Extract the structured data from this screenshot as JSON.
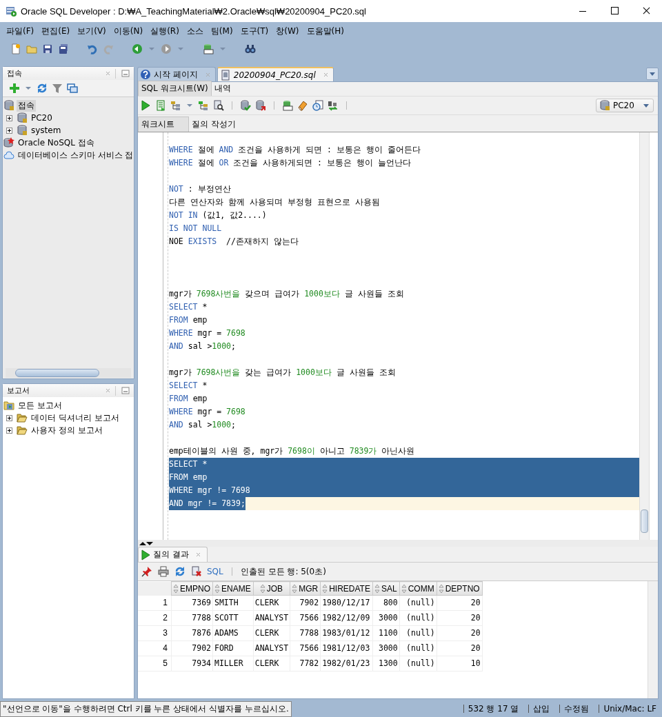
{
  "window": {
    "title": "Oracle SQL Developer : D:₩A_TeachingMaterial₩2.Oracle₩sql₩20200904_PC20.sql"
  },
  "menu": [
    "파일(F)",
    "편집(E)",
    "보기(V)",
    "이동(N)",
    "실행(R)",
    "소스",
    "팀(M)",
    "도구(T)",
    "창(W)",
    "도움말(H)"
  ],
  "connections_panel": {
    "title": "접속",
    "tree": [
      {
        "label": "접속",
        "selected": true,
        "children": [
          {
            "label": "PC20",
            "selected": false,
            "expanded": false
          },
          {
            "label": "system",
            "selected": false,
            "expanded": false
          }
        ]
      },
      {
        "label": "Oracle NoSQL 접속",
        "selected": false
      },
      {
        "label": "데이터베이스 스키마 서비스 접",
        "selected": false
      }
    ]
  },
  "reports_panel": {
    "title": "보고서",
    "tree": [
      {
        "label": "모든 보고서",
        "children": [
          {
            "label": "데이터 딕셔너리 보고서",
            "expanded": false
          },
          {
            "label": "사용자 정의 보고서",
            "expanded": false
          }
        ]
      }
    ]
  },
  "editor_tabs": [
    {
      "label": "시작 페이지",
      "selected": false
    },
    {
      "label": "20200904_PC20.sql",
      "selected": true
    }
  ],
  "worksheet_tabs": [
    {
      "label": "SQL 워크시트(W)",
      "selected": true
    },
    {
      "label": "내역",
      "selected": false
    }
  ],
  "connection_select": {
    "value": "PC20"
  },
  "sub_tabs": [
    {
      "label": "워크시트",
      "selected": true
    },
    {
      "label": "질의 작성기",
      "selected": false
    }
  ],
  "editor": {
    "lines": [
      {
        "selected": false,
        "current": false,
        "tokens": [
          {
            "kind": "keyword",
            "text": "WHERE"
          },
          {
            "kind": "plain",
            "text": " 절에 "
          },
          {
            "kind": "keyword",
            "text": "AND"
          },
          {
            "kind": "plain",
            "text": " 조건을 사용하게 되면 : 보통은 행이 줄어든다"
          }
        ]
      },
      {
        "selected": false,
        "current": false,
        "tokens": [
          {
            "kind": "keyword",
            "text": "WHERE"
          },
          {
            "kind": "plain",
            "text": " 절에 "
          },
          {
            "kind": "keyword",
            "text": "OR"
          },
          {
            "kind": "plain",
            "text": " 조건을 사용하게되면 : 보통은 행이 늘언난다"
          }
        ]
      },
      {
        "selected": false,
        "current": false
      },
      {
        "selected": false,
        "current": false,
        "tokens": [
          {
            "kind": "keyword",
            "text": "NOT"
          },
          {
            "kind": "plain",
            "text": " : 부정연산"
          }
        ]
      },
      {
        "selected": false,
        "current": false,
        "tokens": [
          {
            "kind": "plain",
            "text": "다른 연산자와 함께 사용되며 부정형 표현으로 사용됨"
          }
        ]
      },
      {
        "selected": false,
        "current": false,
        "tokens": [
          {
            "kind": "keyword",
            "text": "NOT IN"
          },
          {
            "kind": "plain",
            "text": " (값1, 값2....)"
          }
        ]
      },
      {
        "selected": false,
        "current": false,
        "tokens": [
          {
            "kind": "keyword",
            "text": "IS NOT NULL"
          }
        ]
      },
      {
        "selected": false,
        "current": false,
        "tokens": [
          {
            "kind": "plain",
            "text": "NOE "
          },
          {
            "kind": "keyword",
            "text": "EXISTS"
          },
          {
            "kind": "plain",
            "text": "  //존재하지 않는다"
          }
        ]
      },
      {
        "selected": false,
        "current": false
      },
      {
        "selected": false,
        "current": false
      },
      {
        "selected": false,
        "current": false
      },
      {
        "selected": false,
        "current": false,
        "tokens": [
          {
            "kind": "plain",
            "text": "mgr가 "
          },
          {
            "kind": "number",
            "text": "7698사번을"
          },
          {
            "kind": "plain",
            "text": " 갖으며 급여가 "
          },
          {
            "kind": "number",
            "text": "1000보다"
          },
          {
            "kind": "plain",
            "text": " 글 사원들 조회"
          }
        ]
      },
      {
        "selected": false,
        "current": false,
        "tokens": [
          {
            "kind": "keyword",
            "text": "SELECT"
          },
          {
            "kind": "plain",
            "text": " *"
          }
        ]
      },
      {
        "selected": false,
        "current": false,
        "tokens": [
          {
            "kind": "keyword",
            "text": "FROM"
          },
          {
            "kind": "plain",
            "text": " emp"
          }
        ]
      },
      {
        "selected": false,
        "current": false,
        "tokens": [
          {
            "kind": "keyword",
            "text": "WHERE"
          },
          {
            "kind": "plain",
            "text": " mgr = "
          },
          {
            "kind": "number",
            "text": "7698"
          }
        ]
      },
      {
        "selected": false,
        "current": false,
        "tokens": [
          {
            "kind": "keyword",
            "text": "AND"
          },
          {
            "kind": "plain",
            "text": " sal >"
          },
          {
            "kind": "number",
            "text": "1000"
          },
          {
            "kind": "plain",
            "text": ";"
          }
        ]
      },
      {
        "selected": false,
        "current": false
      },
      {
        "selected": false,
        "current": false,
        "tokens": [
          {
            "kind": "plain",
            "text": "mgr가 "
          },
          {
            "kind": "number",
            "text": "7698사번을"
          },
          {
            "kind": "plain",
            "text": " 갖는 급여가 "
          },
          {
            "kind": "number",
            "text": "1000보다"
          },
          {
            "kind": "plain",
            "text": " 글 사원들 조회"
          }
        ]
      },
      {
        "selected": false,
        "current": false,
        "tokens": [
          {
            "kind": "keyword",
            "text": "SELECT"
          },
          {
            "kind": "plain",
            "text": " *"
          }
        ]
      },
      {
        "selected": false,
        "current": false,
        "tokens": [
          {
            "kind": "keyword",
            "text": "FROM"
          },
          {
            "kind": "plain",
            "text": " emp"
          }
        ]
      },
      {
        "selected": false,
        "current": false,
        "tokens": [
          {
            "kind": "keyword",
            "text": "WHERE"
          },
          {
            "kind": "plain",
            "text": " mgr = "
          },
          {
            "kind": "number",
            "text": "7698"
          }
        ]
      },
      {
        "selected": false,
        "current": false,
        "tokens": [
          {
            "kind": "keyword",
            "text": "AND"
          },
          {
            "kind": "plain",
            "text": " sal >"
          },
          {
            "kind": "number",
            "text": "1000"
          },
          {
            "kind": "plain",
            "text": ";"
          }
        ]
      },
      {
        "selected": false,
        "current": false
      },
      {
        "selected": false,
        "current": false,
        "tokens": [
          {
            "kind": "plain",
            "text": "emp테이블의 사원 중, mgr가 "
          },
          {
            "kind": "number",
            "text": "7698이"
          },
          {
            "kind": "plain",
            "text": " 아니고 "
          },
          {
            "kind": "number",
            "text": "7839가"
          },
          {
            "kind": "plain",
            "text": " 아닌사원"
          }
        ]
      },
      {
        "selected": true,
        "current": false,
        "tokens": [
          {
            "kind": "keyword",
            "text": "SELECT"
          },
          {
            "kind": "plain",
            "text": " *"
          }
        ]
      },
      {
        "selected": true,
        "current": false,
        "tokens": [
          {
            "kind": "keyword",
            "text": "FROM"
          },
          {
            "kind": "plain",
            "text": " emp"
          }
        ]
      },
      {
        "selected": true,
        "current": false,
        "tokens": [
          {
            "kind": "keyword",
            "text": "WHERE"
          },
          {
            "kind": "plain",
            "text": " mgr != "
          },
          {
            "kind": "number",
            "text": "7698"
          }
        ]
      },
      {
        "selected": true,
        "current": true,
        "tokens": [
          {
            "kind": "keyword",
            "text": "AND"
          },
          {
            "kind": "plain",
            "text": " mgr != "
          },
          {
            "kind": "number",
            "text": "7839"
          },
          {
            "kind": "plain",
            "text": ";"
          }
        ]
      }
    ]
  },
  "results": {
    "tab": "질의 결과",
    "sql_link": "SQL",
    "message": "인출된 모든 행: 5(0초)",
    "columns": [
      {
        "label": "EMPNO",
        "kind": "number"
      },
      {
        "label": "ENAME",
        "kind": "text"
      },
      {
        "label": "JOB",
        "kind": "text"
      },
      {
        "label": "MGR",
        "kind": "number"
      },
      {
        "label": "HIREDATE",
        "kind": "text"
      },
      {
        "label": "SAL",
        "kind": "number"
      },
      {
        "label": "COMM",
        "kind": "number"
      },
      {
        "label": "DEPTNO",
        "kind": "number"
      }
    ],
    "rows": [
      {
        "number": "1",
        "cells": [
          "7369",
          "SMITH",
          "CLERK",
          "7902",
          "1980/12/17",
          "800",
          "(null)",
          "20"
        ]
      },
      {
        "number": "2",
        "cells": [
          "7788",
          "SCOTT",
          "ANALYST",
          "7566",
          "1982/12/09",
          "3000",
          "(null)",
          "20"
        ]
      },
      {
        "number": "3",
        "cells": [
          "7876",
          "ADAMS",
          "CLERK",
          "7788",
          "1983/01/12",
          "1100",
          "(null)",
          "20"
        ]
      },
      {
        "number": "4",
        "cells": [
          "7902",
          "FORD",
          "ANALYST",
          "7566",
          "1981/12/03",
          "3000",
          "(null)",
          "20"
        ]
      },
      {
        "number": "5",
        "cells": [
          "7934",
          "MILLER",
          "CLERK",
          "7782",
          "1982/01/23",
          "1300",
          "(null)",
          "10"
        ]
      }
    ]
  },
  "status_bar": {
    "hint": "\"선언으로 이동\"을 수행하려면 Ctrl 키를 누른 상태에서 식별자를 누르십시오.",
    "position": "532 행 17 열",
    "mode": "삽입",
    "modified": "수정됨",
    "line_ending": "Unix/Mac: LF"
  }
}
